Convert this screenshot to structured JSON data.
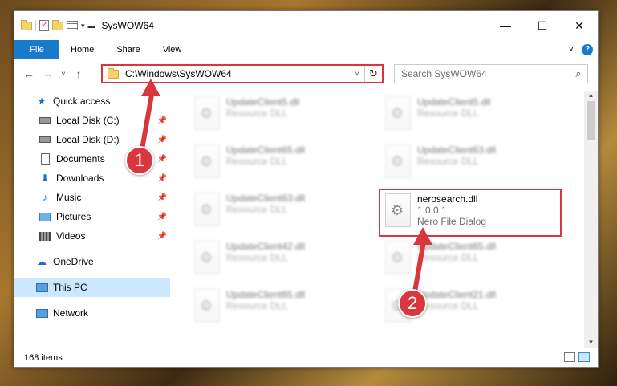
{
  "window": {
    "title": "SysWOW64"
  },
  "ribbon": {
    "tabs": [
      "File",
      "Home",
      "Share",
      "View"
    ]
  },
  "navbar": {
    "address": "C:\\Windows\\SysWOW64",
    "search_placeholder": "Search SysWOW64"
  },
  "sidebar": {
    "items": [
      {
        "label": "Quick access",
        "icon": "star-icon"
      },
      {
        "label": "Local Disk (C:)",
        "icon": "drive-icon",
        "pinned": true
      },
      {
        "label": "Local Disk (D:)",
        "icon": "drive-icon",
        "pinned": true
      },
      {
        "label": "Documents",
        "icon": "documents-icon",
        "pinned": true
      },
      {
        "label": "Downloads",
        "icon": "downloads-icon",
        "pinned": true
      },
      {
        "label": "Music",
        "icon": "music-icon",
        "pinned": true
      },
      {
        "label": "Pictures",
        "icon": "pictures-icon",
        "pinned": true
      },
      {
        "label": "Videos",
        "icon": "videos-icon",
        "pinned": true
      },
      {
        "label": "OneDrive",
        "icon": "onedrive-icon"
      },
      {
        "label": "This PC",
        "icon": "this-pc-icon",
        "selected": true
      },
      {
        "label": "Network",
        "icon": "network-icon"
      }
    ]
  },
  "files": [
    {
      "name": "UpdateClient5.dll",
      "type": "Resource DLL"
    },
    {
      "name": "UpdateClient5.dll",
      "type": "Resource DLL"
    },
    {
      "name": "UpdateClient65.dll",
      "type": "Resource DLL"
    },
    {
      "name": "UpdateClient63.dll",
      "type": "Resource DLL"
    },
    {
      "name": "UpdateClient63.dll",
      "type": "Resource DLL"
    },
    {
      "name": "nerosearch.dll",
      "version": "1.0.0.1",
      "type": "Nero File Dialog",
      "highlighted": true
    },
    {
      "name": "UpdateClient42.dll",
      "type": "Resource DLL"
    },
    {
      "name": "UpdateClient65.dll",
      "type": "Resource DLL"
    },
    {
      "name": "UpdateClient65.dll",
      "type": "Resource DLL"
    },
    {
      "name": "UpdateClient21.dll",
      "type": "Resource DLL"
    }
  ],
  "status": {
    "item_count": "168 items"
  },
  "annotations": {
    "step1": "1",
    "step2": "2"
  },
  "colors": {
    "accent": "#1979ca",
    "annotation": "#d9363e",
    "selection": "#cce8ff"
  }
}
